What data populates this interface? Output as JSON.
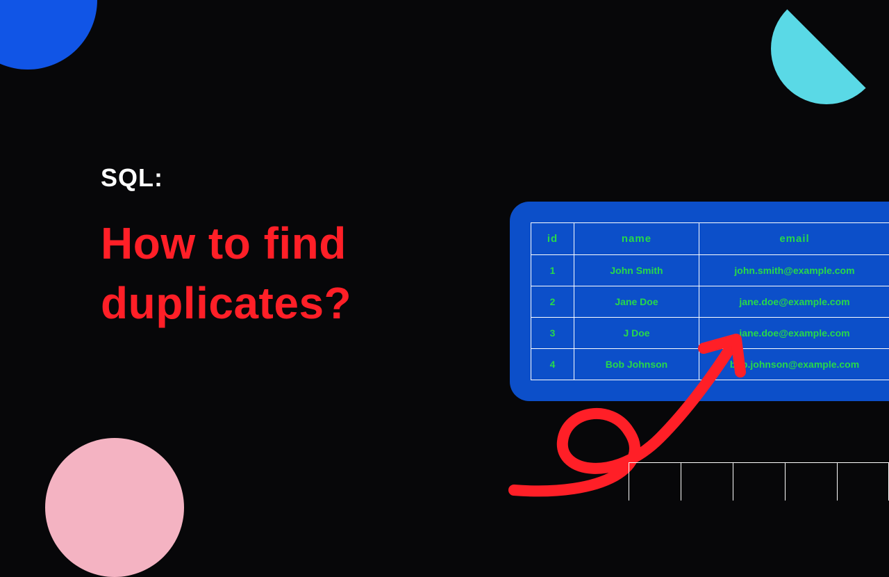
{
  "label": "SQL:",
  "headline_line1": "How to find",
  "headline_line2": "duplicates?",
  "table": {
    "headers": {
      "c0": "id",
      "c1": "name",
      "c2": "email"
    },
    "rows": [
      {
        "c0": "1",
        "c1": "John Smith",
        "c2": "john.smith@example.com"
      },
      {
        "c0": "2",
        "c1": "Jane Doe",
        "c2": "jane.doe@example.com"
      },
      {
        "c0": "3",
        "c1": "J Doe",
        "c2": "jane.doe@example.com"
      },
      {
        "c0": "4",
        "c1": "Bob Johnson",
        "c2": "bob.johnson@example.com"
      }
    ]
  }
}
